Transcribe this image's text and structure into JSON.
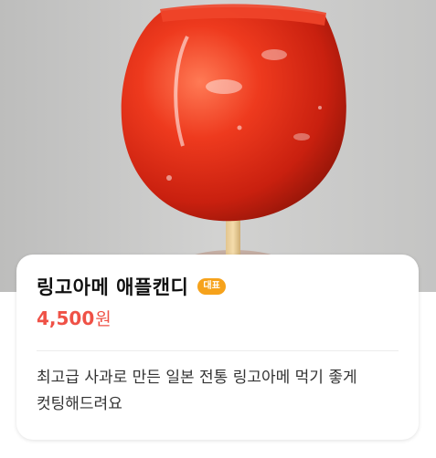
{
  "product": {
    "title": "링고아메 애플캔디",
    "badge": "대표",
    "price": "4,500",
    "currency": "원",
    "description": "최고급 사과로 만든 일본 전통 링고아메 먹기 좋게 컷팅해드려요"
  },
  "colors": {
    "price": "#ef5146",
    "badge": "#f6a21b",
    "apple": "#e0301c"
  }
}
